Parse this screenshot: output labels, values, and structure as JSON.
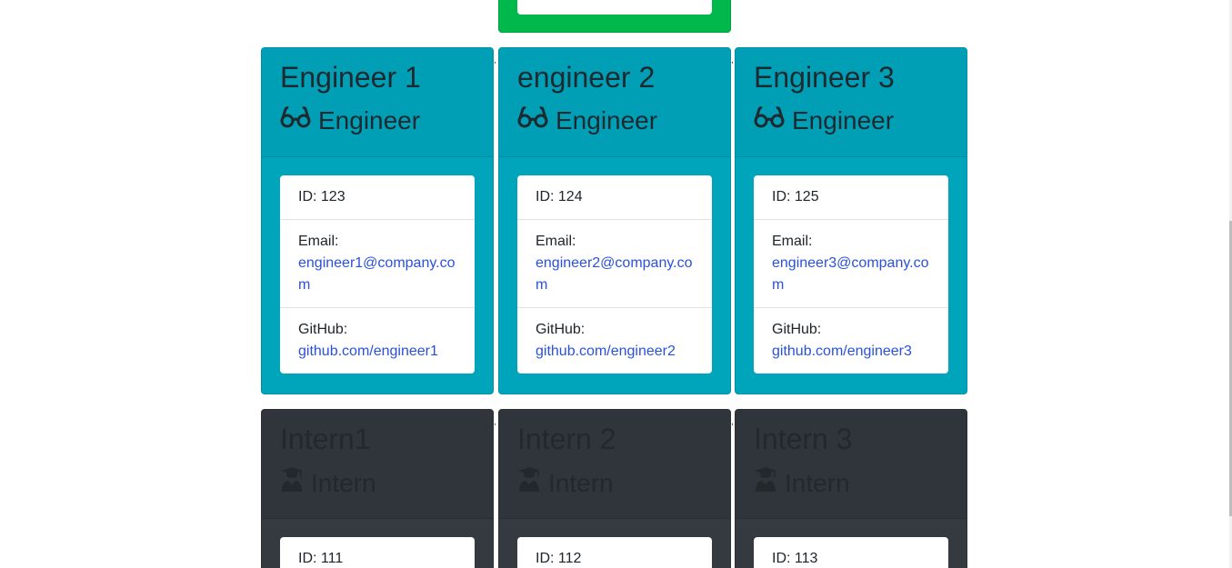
{
  "engineers": [
    {
      "name": "Engineer 1",
      "role": "Engineer",
      "role_icon": "glasses-icon",
      "id_text": "ID: 123",
      "email_label": "Email:",
      "email": "engineer1@company.com",
      "github_label": "GitHub:",
      "github": "github.com/engineer1"
    },
    {
      "name": "engineer 2",
      "role": "Engineer",
      "role_icon": "glasses-icon",
      "id_text": "ID: 124",
      "email_label": "Email:",
      "email": "engineer2@company.com",
      "github_label": "GitHub:",
      "github": "github.com/engineer2"
    },
    {
      "name": "Engineer 3",
      "role": "Engineer",
      "role_icon": "glasses-icon",
      "id_text": "ID: 125",
      "email_label": "Email:",
      "email": "engineer3@company.com",
      "github_label": "GitHub:",
      "github": "github.com/engineer3"
    }
  ],
  "interns": [
    {
      "name": "Intern1",
      "role": "Intern",
      "role_icon": "graduate-icon",
      "id_text": "ID: 111"
    },
    {
      "name": "Intern 2",
      "role": "Intern",
      "role_icon": "graduate-icon",
      "id_text": "ID: 112"
    },
    {
      "name": "Intern 3",
      "role": "Intern",
      "role_icon": "graduate-icon",
      "id_text": "ID: 113"
    }
  ],
  "separators": [
    ",",
    ","
  ],
  "colors": {
    "manager_card": "#00b84b",
    "engineer_card": "#00a4bb",
    "intern_card": "#343a40",
    "link": "#2a50e0"
  }
}
